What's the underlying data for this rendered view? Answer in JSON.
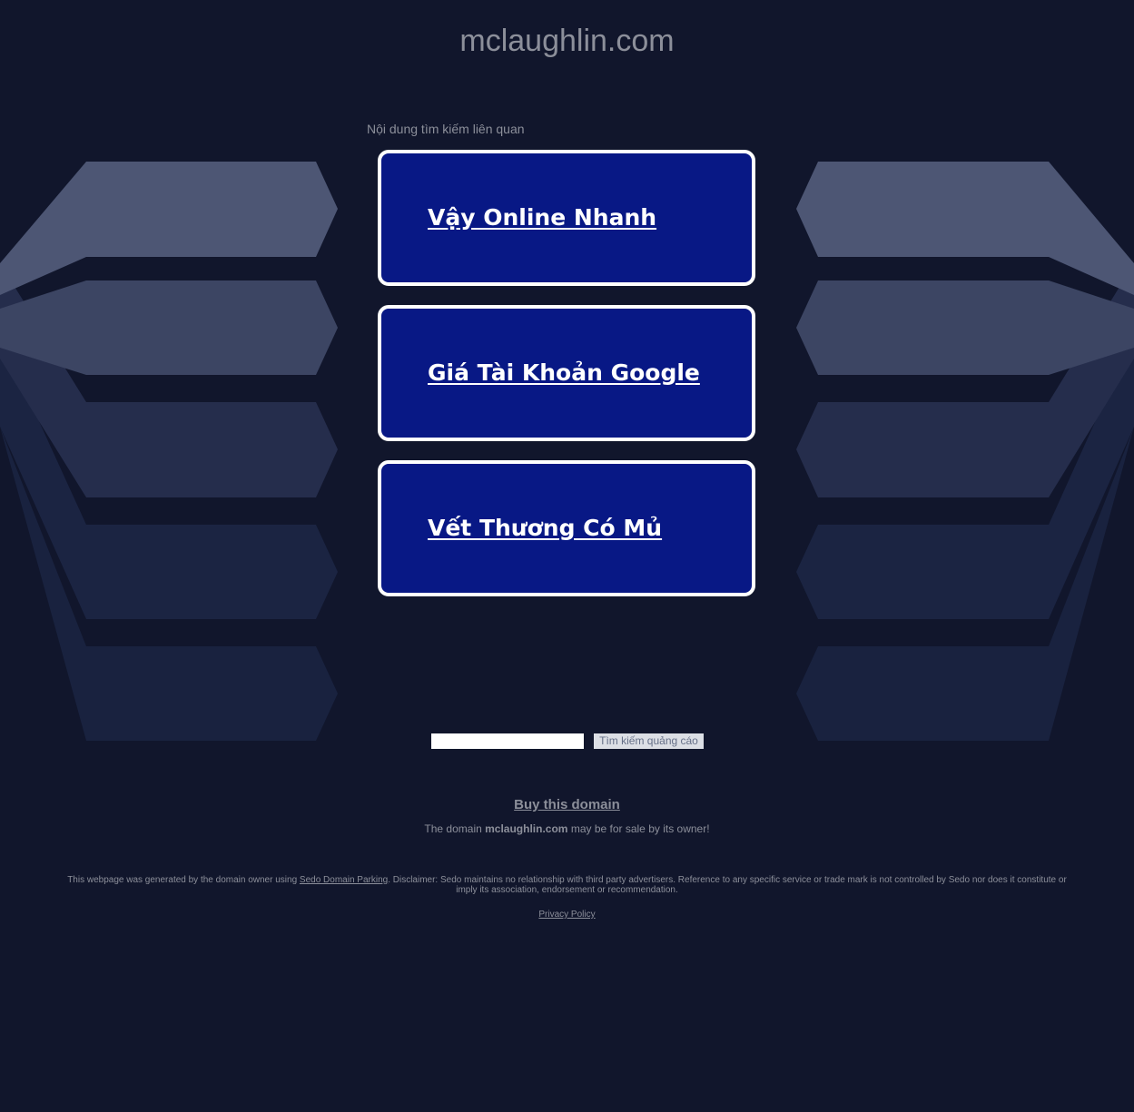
{
  "header": {
    "domain": "mclaughlin.com"
  },
  "related": {
    "label": "Nội dung tìm kiếm liên quan",
    "links": [
      {
        "label": "Vậy Online Nhanh"
      },
      {
        "label": "Giá Tài Khoản Google"
      },
      {
        "label": "Vết Thương Có Mủ"
      }
    ]
  },
  "search": {
    "value": "",
    "button_label": "Tìm kiếm quảng cáo"
  },
  "sale": {
    "buy_link": "Buy this domain",
    "note_prefix": "The domain ",
    "note_domain": "mclaughlin.com",
    "note_suffix": " may be for sale by its owner!"
  },
  "footer": {
    "disclaimer_prefix": "This webpage was generated by the domain owner using ",
    "disclaimer_link": "Sedo Domain Parking",
    "disclaimer_suffix": ". Disclaimer: Sedo maintains no relationship with third party advertisers. Reference to any specific service or trade mark is not controlled by Sedo nor does it constitute or imply its association, endorsement or recommendation.",
    "privacy_link": "Privacy Policy"
  },
  "colors": {
    "background": "#11162c",
    "link_box_fill": "#081885",
    "link_box_border": "#ffffff",
    "text_muted": "#8c8f9a"
  }
}
